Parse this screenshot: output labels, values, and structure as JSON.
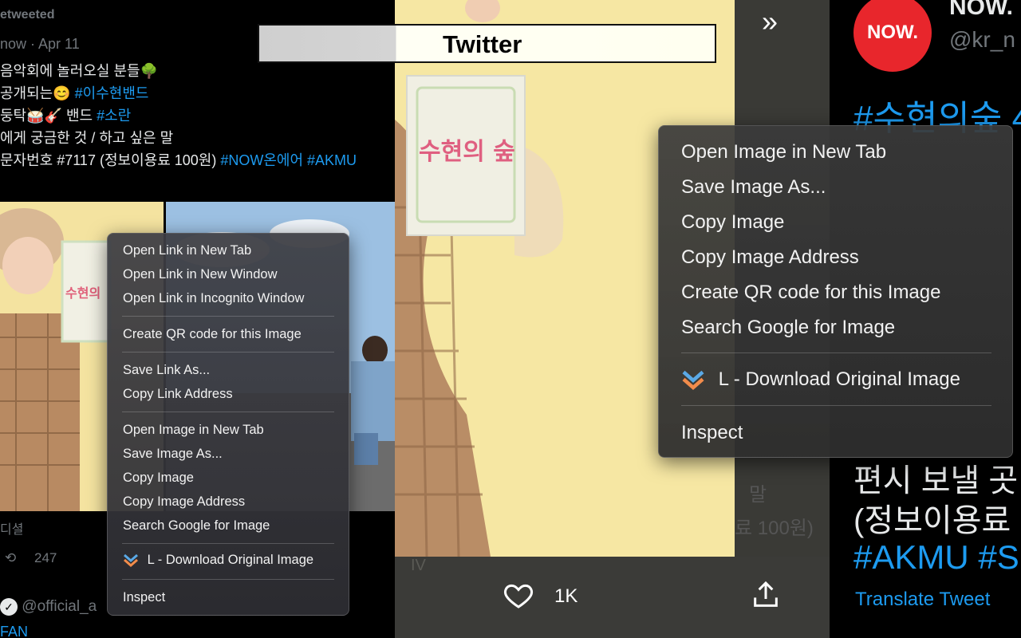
{
  "app": {
    "title": "Twitter"
  },
  "left_tweet": {
    "retweeted_label": "etweeted",
    "time": "now · Apr 11",
    "lines": [
      "음악회에 놀러오실 분들🌳",
      "공개되는😊",
      "둥탁🥁🎸 밴드",
      "에게 궁금한 것 / 하고 싶은 말",
      "문자번호 #7117 (정보이용료 100원)"
    ],
    "hashtags": {
      "line2": "#이수현밴드",
      "line3": "#소란",
      "line5": "#NOW온에어 #AKMU"
    },
    "footer_label": "디셜",
    "retweet_count": "247",
    "next_handle": "@official_a",
    "next_fan_text": "FAN"
  },
  "small_menu": {
    "items": [
      "Open Link in New Tab",
      "Open Link in New Window",
      "Open Link in Incognito Window",
      "Create QR code for this Image",
      "Save Link As...",
      "Copy Link Address",
      "Open Image in New Tab",
      "Save Image As...",
      "Copy Image",
      "Copy Image Address",
      "Search Google for Image",
      "L - Download Original Image",
      "Inspect"
    ]
  },
  "middle": {
    "sign_text": "수현의 숲",
    "like_count": "1K",
    "overlay_text_1": "말",
    "overlay_text_2": "료 100원)",
    "overlay_text_3": "IV"
  },
  "large_menu": {
    "items": [
      "Open Image in New Tab",
      "Save Image As...",
      "Copy Image",
      "Copy Image Address",
      "Create QR code for this Image",
      "Search Google for Image",
      "L - Download Original Image",
      "Inspect"
    ]
  },
  "right_tweet": {
    "logo_text": "NOW.",
    "name": "NOW.",
    "handle": "@kr_n",
    "hashtag_line": "#수현의숲 4",
    "line_a": "편시 보낼 곳",
    "line_b": "(정보이용료",
    "line_c": "#AKMU #S",
    "translate": "Translate Tweet"
  },
  "colors": {
    "accent": "#1d9bf0",
    "now_logo": "#e8262c",
    "yellow_bg": "#f7e9a6"
  }
}
